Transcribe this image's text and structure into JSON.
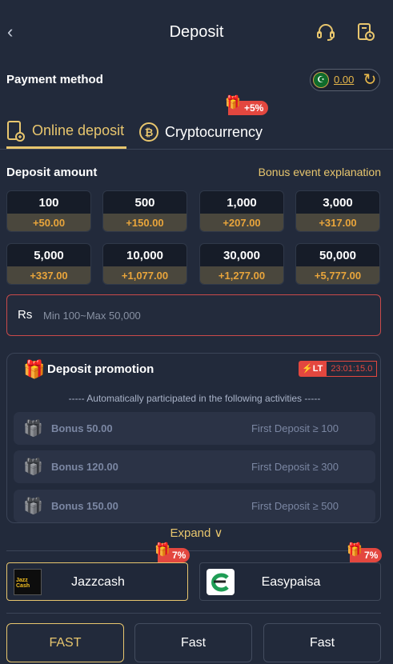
{
  "header": {
    "title": "Deposit",
    "back_icon": "chevron-left-icon",
    "support_icon": "headset-icon",
    "history_icon": "record-clock-icon"
  },
  "payment_method": {
    "label": "Payment method",
    "balance": "0.00",
    "currency_flag_symbol": "☪"
  },
  "tabs": [
    {
      "label": "Online deposit",
      "icon": "phone-deposit-icon",
      "active": true
    },
    {
      "label": "Cryptocurrency",
      "icon": "bitcoin-icon",
      "badge": "+5%"
    }
  ],
  "deposit_amount": {
    "label": "Deposit amount",
    "bonus_link": "Bonus event explanation",
    "options": [
      {
        "amount": "100",
        "bonus": "+50.00"
      },
      {
        "amount": "500",
        "bonus": "+150.00"
      },
      {
        "amount": "1,000",
        "bonus": "+207.00"
      },
      {
        "amount": "3,000",
        "bonus": "+317.00"
      },
      {
        "amount": "5,000",
        "bonus": "+337.00"
      },
      {
        "amount": "10,000",
        "bonus": "+1,077.00"
      },
      {
        "amount": "30,000",
        "bonus": "+1,277.00"
      },
      {
        "amount": "50,000",
        "bonus": "+5,777.00"
      }
    ]
  },
  "amount_input": {
    "currency": "Rs",
    "placeholder": "Min 100~Max 50,000"
  },
  "promotion": {
    "title": "Deposit promotion",
    "tag": "LT",
    "countdown": "23:01:15.0",
    "note": "----- Automatically participated in the following activities -----",
    "rows": [
      {
        "bonus": "Bonus 50.00",
        "condition": "First Deposit ≥ 100"
      },
      {
        "bonus": "Bonus 120.00",
        "condition": "First Deposit ≥ 300"
      },
      {
        "bonus": "Bonus 150.00",
        "condition": "First Deposit ≥ 500"
      }
    ],
    "expand": "Expand"
  },
  "channels": [
    {
      "label": "Jazzcash",
      "badge": "7%",
      "logo_text": "Jazz Cash",
      "active": true
    },
    {
      "label": "Easypaisa",
      "badge": "7%"
    }
  ],
  "speed_options": [
    "FAST",
    "Fast",
    "Fast"
  ],
  "colors": {
    "accent": "#e8c66e",
    "bonus": "#e9a53b",
    "alert": "#e3473f",
    "background": "#222a3b"
  }
}
